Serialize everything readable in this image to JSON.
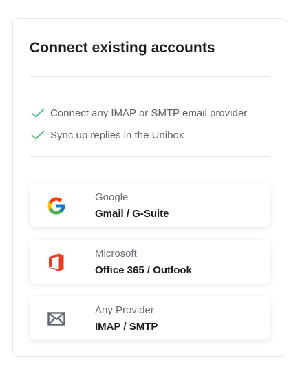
{
  "card": {
    "title": "Connect existing accounts",
    "features": [
      {
        "text": "Connect any IMAP or SMTP email provider",
        "icon": "check-icon"
      },
      {
        "text": "Sync up replies in the Unibox",
        "icon": "check-icon"
      }
    ],
    "providers": [
      {
        "name": "Google",
        "description": "Gmail / G-Suite",
        "icon": "google-icon"
      },
      {
        "name": "Microsoft",
        "description": "Office 365 / Outlook",
        "icon": "office-icon"
      },
      {
        "name": "Any Provider",
        "description": "IMAP / SMTP",
        "icon": "mail-icon"
      }
    ]
  },
  "colors": {
    "check": "#3fc17a",
    "office": "#ea3e23",
    "mail_icon": "#5f6670",
    "google_blue": "#4285F4",
    "google_red": "#EA4335",
    "google_yellow": "#FBBC05",
    "google_green": "#34A853"
  }
}
